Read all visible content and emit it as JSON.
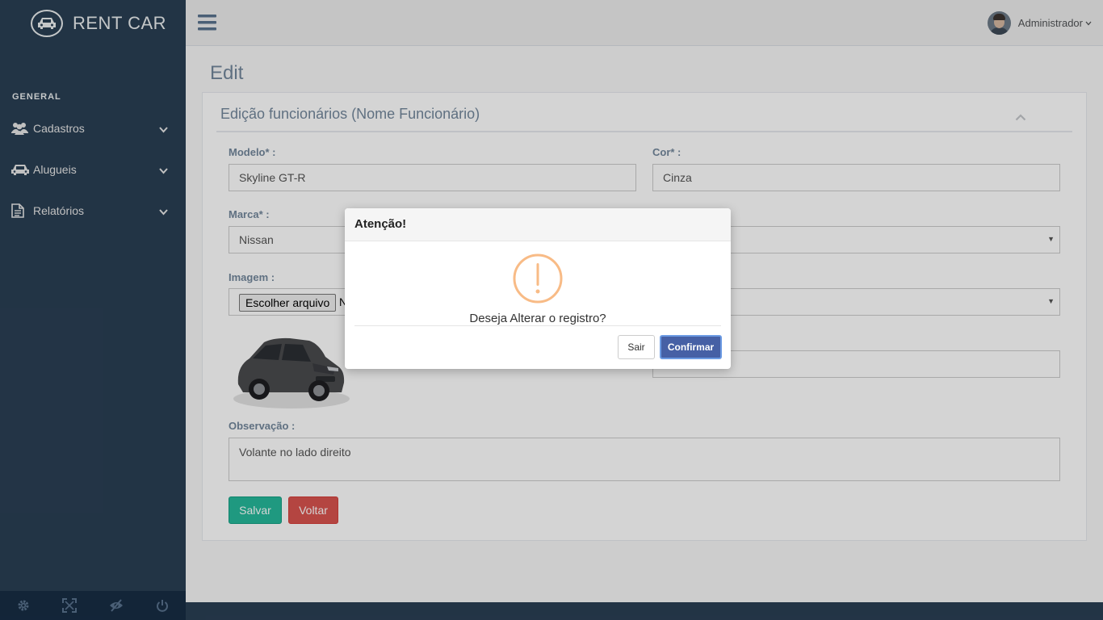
{
  "brand": {
    "name": "RENT CAR",
    "icon": "car-icon"
  },
  "sidebar": {
    "section_label": "GENERAL",
    "items": [
      {
        "label": "Cadastros",
        "icon": "users-icon"
      },
      {
        "label": "Alugueis",
        "icon": "car-icon"
      },
      {
        "label": "Relatórios",
        "icon": "document-icon"
      }
    ],
    "footer_icons": [
      "gear-icon",
      "fullscreen-icon",
      "eye-slash-icon",
      "power-icon"
    ]
  },
  "topnav": {
    "user_name": "Administrador"
  },
  "page": {
    "title": "Edit"
  },
  "panel": {
    "title": "Edição funcionários (Nome Funcionário)",
    "fields": {
      "modelo": {
        "label": "Modelo* :",
        "value": "Skyline GT-R"
      },
      "cor": {
        "label": "Cor* :",
        "value": "Cinza"
      },
      "marca": {
        "label": "Marca* :",
        "value": "Nissan"
      },
      "imagem": {
        "label": "Imagem :",
        "button": "Escolher arquivo",
        "filename": "N"
      },
      "observacao": {
        "label": "Observação :",
        "value": "Volante no lado direito"
      }
    },
    "buttons": {
      "save": "Salvar",
      "back": "Voltar"
    }
  },
  "modal": {
    "title": "Atenção!",
    "message": "Deseja Alterar o registro?",
    "exit_label": "Sair",
    "confirm_label": "Confirmar",
    "icon": "warning-icon"
  },
  "colors": {
    "sidebar": "#2A3F54",
    "accent_green": "#26B99A",
    "accent_red": "#D9534F",
    "confirm_blue": "#4660A5",
    "warning": "#F8BB86"
  }
}
